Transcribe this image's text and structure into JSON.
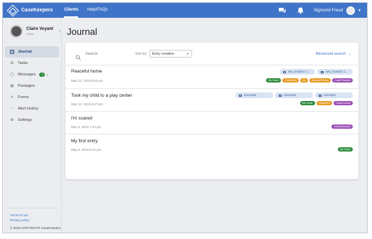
{
  "app": {
    "logo_text": "CaseKeepers",
    "nav": [
      "Clients",
      "Help/FAQs"
    ],
    "user_name": "Sigmund Freud"
  },
  "profile": {
    "name": "Claire Voyant",
    "role": "Client"
  },
  "sidebar": {
    "items": [
      {
        "label": "Journal",
        "icon": "book-icon"
      },
      {
        "label": "Tasks",
        "icon": "list-icon"
      },
      {
        "label": "Messages",
        "icon": "chat-icon",
        "badge": "1"
      },
      {
        "label": "Packages",
        "icon": "package-icon"
      },
      {
        "label": "Forms",
        "icon": "form-icon"
      },
      {
        "label": "Alert history",
        "icon": "alert-icon"
      },
      {
        "label": "Settings",
        "icon": "gear-icon"
      }
    ],
    "footer_links": [
      "Terms of use",
      "Privacy policy"
    ],
    "copyright": "© 2019 COPYRIGHT CaseKeepers"
  },
  "page": {
    "title": "Journal"
  },
  "toolbar": {
    "search_placeholder": "Search",
    "sort_label": "Sort by",
    "sort_value": "Entry creation",
    "advanced_search": "Advanced search"
  },
  "colors": {
    "topbar": "#3f74c8",
    "green": "#2e8b3c",
    "orange": "#e69a22",
    "purple": "#9a4fb4"
  },
  "entries": [
    {
      "title": "Peaceful home",
      "date": "May 12, 2019 9:53 pm",
      "files": [
        "IMG_20180207.1...",
        "IMG_20180207.1..."
      ],
      "tags": [
        {
          "label": "My Home",
          "color": "#2e8b3c"
        },
        {
          "label": "Child(Ren)",
          "color": "#e69a22"
        },
        {
          "label": "Me",
          "color": "#e69a22"
        },
        {
          "label": "Spouse/Partner",
          "color": "#e69a22"
        },
        {
          "label": "Calm/Peaceful",
          "color": "#9a4fb4"
        }
      ]
    },
    {
      "title": "Took my child to a play center",
      "date": "May 12, 2019 9:47 pm",
      "files": [
        "DSC00008",
        "DSC00005",
        "DSC00001"
      ],
      "tags": [
        {
          "label": "My Home",
          "color": "#2e8b3c"
        },
        {
          "label": "Child(Ren)",
          "color": "#e69a22"
        },
        {
          "label": "Glad/Content",
          "color": "#9a4fb4"
        }
      ]
    },
    {
      "title": "I'm scared",
      "date": "May 6, 2019 7:43 pm",
      "files": [],
      "tags": [
        {
          "label": "Anxiety/Scared",
          "color": "#9a4fb4"
        }
      ]
    },
    {
      "title": "My first entry",
      "date": "May 5, 2019 5:31 pm",
      "files": [],
      "tags": [
        {
          "label": "My Home",
          "color": "#2e8b3c"
        }
      ]
    }
  ]
}
